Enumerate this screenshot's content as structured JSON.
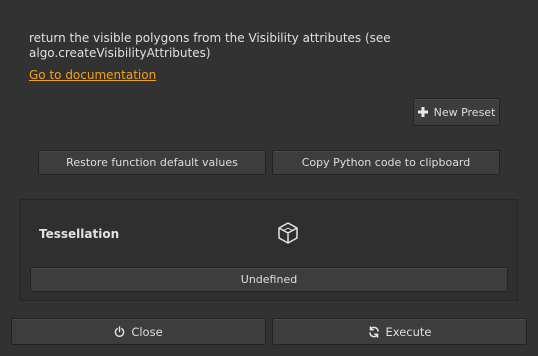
{
  "description": "return the visible polygons from the Visibility attributes (see algo.createVisibilityAttributes)",
  "documentation_link": "Go to documentation",
  "buttons": {
    "new_preset": "New Preset",
    "restore_defaults": "Restore function default values",
    "copy_python": "Copy Python code to clipboard",
    "close": "Close",
    "execute": "Execute"
  },
  "tessellation": {
    "title": "Tessellation",
    "icon": "cube-icon",
    "value": "Undefined"
  },
  "colors": {
    "background": "#323232",
    "link": "#f0a21e",
    "button": "#3d3d3d"
  }
}
